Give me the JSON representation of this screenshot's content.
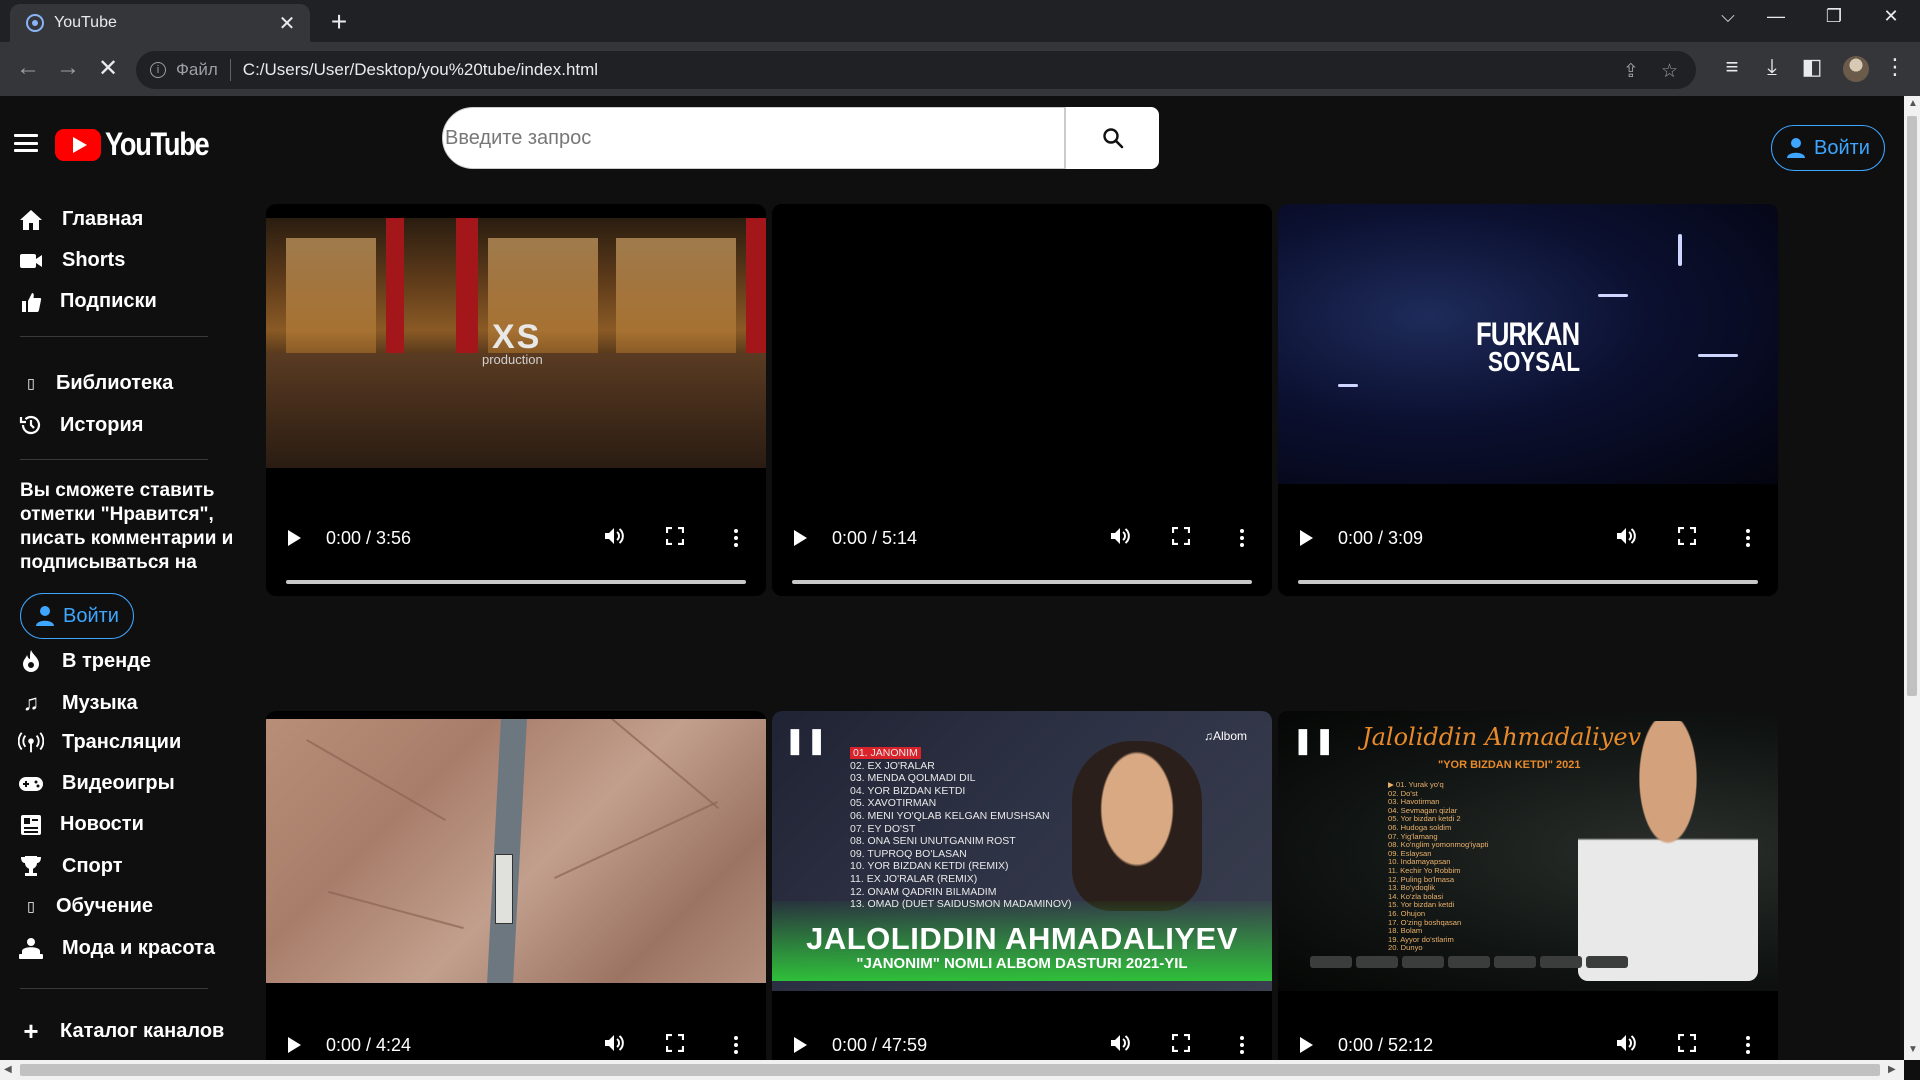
{
  "browser": {
    "tab_title": "YouTube",
    "tab_close": "✕",
    "new_tab": "+",
    "site_chip": "Файл",
    "url": "C:/Users/User/Desktop/you%20tube/index.html"
  },
  "header": {
    "logo_text": "YouTube",
    "search_placeholder": "Введите запрос",
    "signin_label": "Войти"
  },
  "sidebar": {
    "items_main": [
      {
        "label": "Главная",
        "icon": "home-icon"
      },
      {
        "label": "Shorts",
        "icon": "shorts-icon"
      },
      {
        "label": "Подписки",
        "icon": "subscriptions-icon"
      }
    ],
    "items_library": [
      {
        "label": "Библиотека",
        "icon": "library-icon"
      },
      {
        "label": "История",
        "icon": "history-icon"
      }
    ],
    "note": "Вы сможете ставить отметки \"Нравится\", писать комментарии и подписываться на",
    "signin_label": "Войти",
    "items_explore": [
      {
        "label": "В тренде",
        "icon": "trending-icon"
      },
      {
        "label": "Музыка",
        "icon": "music-icon"
      },
      {
        "label": "Трансляции",
        "icon": "live-icon"
      },
      {
        "label": "Видеоигры",
        "icon": "gaming-icon"
      },
      {
        "label": "Новости",
        "icon": "news-icon"
      },
      {
        "label": "Спорт",
        "icon": "sports-icon"
      },
      {
        "label": "Обучение",
        "icon": "learning-icon"
      },
      {
        "label": "Мода и красота",
        "icon": "fashion-icon"
      }
    ],
    "catalog_label": "Каталог каналов"
  },
  "videos": [
    {
      "time": "0:00 / 3:56",
      "overlay": "XS",
      "overlay_sub": "production"
    },
    {
      "time": "0:00 / 5:14"
    },
    {
      "time": "0:00 / 3:09",
      "overlay": "FURKAN",
      "overlay_sub": "SOYSAL"
    },
    {
      "time": "0:00 / 4:24"
    },
    {
      "time": "0:00 / 47:59",
      "overlay": "JALOLIDDIN AHMADALIYEV",
      "overlay_sub": "\"JANONIM\" NOMLI ALBOM DASTURI 2021-YIL",
      "badge": "♫Albom",
      "tracks_first": "01. JANONIM",
      "tracks_rest": "02. EX JO'RALAR\n03. MENDA QOLMADI DIL\n04. YOR BIZDAN KETDI\n05. XAVOTIRMAN\n06. MENI YO'QLAB KELGAN EMUSHSAN\n07. EY DO'ST\n08. ONA SENI UNUTGANIM ROST\n09. TUPROQ BO'LASAN\n10. YOR BIZDAN KETDI (REMIX)\n11. EX JO'RALAR (REMIX)\n12. ONAM QADRIN BILMADIM\n13. OMAD (DUET SAIDUSMON MADAMINOV)"
    },
    {
      "time": "0:00 / 52:12",
      "overlay": "Jaloliddin Ahmadaliyev",
      "overlay_sub": "\"YOR BIZDAN KETDI\" 2021",
      "tracks": "▶ 01. Yurak yo'q\n02. Do'st\n03. Havotirman\n04. Sevmagan qizlar\n05. Yor bizdan ketdi 2\n06. Hudoga soldim\n07. Yig'lamang\n08. Ko'nglim yomonmog'iyapti\n09. Eslaysan\n10. Indamayapsan\n11. Kechir Yo Robbim\n12. Puling bo'lmasa\n13. Bo'ydoqlik\n14. Ko'zla bolasi\n15. Yor bizdan ketdi\n16. Ohujon\n17. O'zing boshqasan\n18. Bolam\n19. Ayyor do'stlarim\n20. Dunyo"
    }
  ]
}
